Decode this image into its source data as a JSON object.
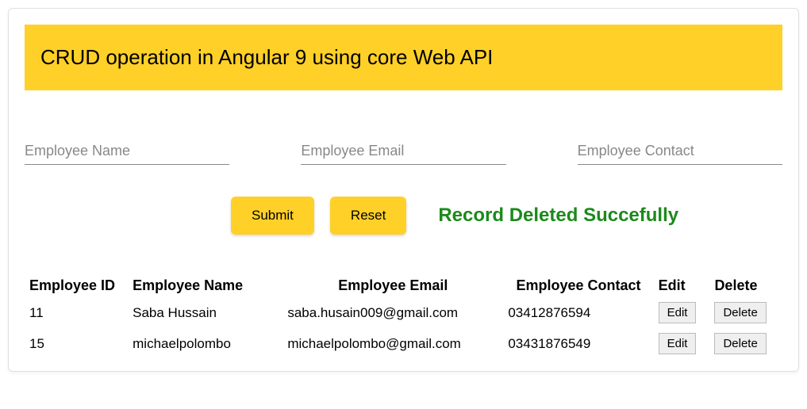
{
  "header": {
    "title": "CRUD operation in Angular 9 using core Web API"
  },
  "form": {
    "name_placeholder": "Employee Name",
    "email_placeholder": "Employee Email",
    "contact_placeholder": "Employee Contact",
    "submit_label": "Submit",
    "reset_label": "Reset"
  },
  "message": "Record Deleted Succefully",
  "table": {
    "headers": {
      "id": "Employee ID",
      "name": "Employee Name",
      "email": "Employee Email",
      "contact": "Employee Contact",
      "edit": "Edit",
      "delete": "Delete"
    },
    "rows": [
      {
        "id": "11",
        "name": "Saba Hussain",
        "email": "saba.husain009@gmail.com",
        "contact": "03412876594",
        "edit_label": "Edit",
        "delete_label": "Delete"
      },
      {
        "id": "15",
        "name": "michaelpolombo",
        "email": "michaelpolombo@gmail.com",
        "contact": "03431876549",
        "edit_label": "Edit",
        "delete_label": "Delete"
      }
    ]
  }
}
